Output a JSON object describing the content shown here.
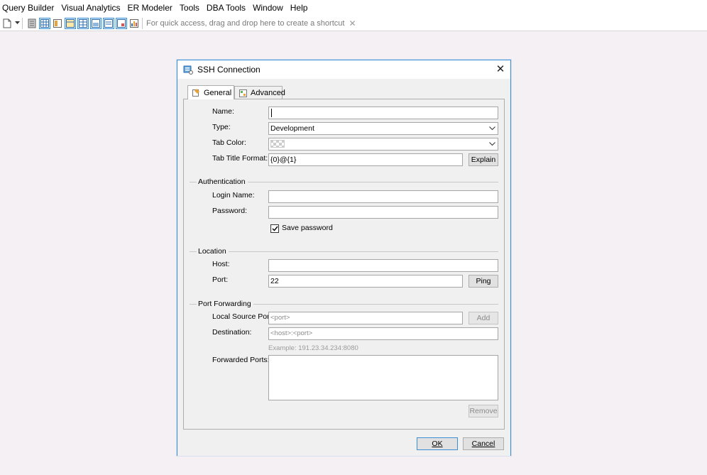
{
  "menu": {
    "items": [
      "Query Builder",
      "Visual Analytics",
      "ER Modeler",
      "Tools",
      "DBA Tools",
      "Window",
      "Help"
    ]
  },
  "toolbar": {
    "hint": "For quick access, drag and drop here to create a shortcut",
    "hint_close": "✕"
  },
  "dialog": {
    "title": "SSH Connection",
    "close": "✕",
    "tabs": {
      "general": "General",
      "advanced": "Advanced",
      "selected": "General"
    },
    "general": {
      "name_label": "Name:",
      "name_value": "",
      "type_label": "Type:",
      "type_value": "Development",
      "tab_color_label": "Tab Color:",
      "tab_title_format_label": "Tab Title Format:",
      "tab_title_format_value": "{0}@{1}",
      "explain_button": "Explain"
    },
    "authentication": {
      "section": "Authentication",
      "login_name_label": "Login Name:",
      "login_name_value": "",
      "password_label": "Password:",
      "password_value": "",
      "save_password_label": "Save password",
      "save_password_checked": true
    },
    "location": {
      "section": "Location",
      "host_label": "Host:",
      "host_value": "",
      "port_label": "Port:",
      "port_value": "22",
      "ping_button": "Ping"
    },
    "port_forwarding": {
      "section": "Port Forwarding",
      "local_source_port_label": "Local Source Port:",
      "local_source_port_placeholder": "<port>",
      "add_button": "Add",
      "destination_label": "Destination:",
      "destination_placeholder": "<host>:<port>",
      "destination_example": "Example: 191.23.34.234:8080",
      "forwarded_ports_label": "Forwarded Ports:",
      "remove_button": "Remove"
    },
    "footer": {
      "ok_button": "OK",
      "cancel_button": "Cancel"
    }
  },
  "colors": {
    "accent": "#3c8fd4",
    "background": "#f4f0f4",
    "dialog_body": "#f0f0f0"
  }
}
